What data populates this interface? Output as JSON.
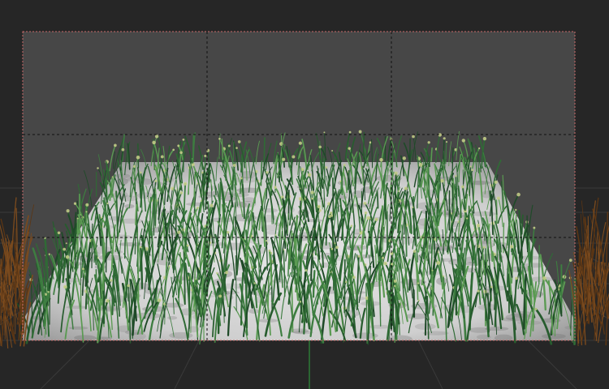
{
  "viewport": {
    "name": "3d-perspective-viewport",
    "show_grid": true,
    "safe_frame": true,
    "thirds_guides": true,
    "colors": {
      "background": "#262626",
      "ground_grid": "#3a3a3a",
      "camera_frame_fill": "#474747",
      "camera_frame_border": "#c96a6a",
      "thirds_guides": "#111111",
      "plane": "#d8d8d8",
      "grass_dark": "#1f4a28",
      "grass_mid": "#2f6b35",
      "grass_light": "#5a9a52",
      "seed_heads": "#c8d08a",
      "dry_grass": "#7a4a1e",
      "y_axis": "#2f8f3a"
    },
    "objects": [
      {
        "icon": "grass-field-object"
      },
      {
        "icon": "dry-grass-clump-left"
      },
      {
        "icon": "dry-grass-clump-right"
      }
    ]
  }
}
